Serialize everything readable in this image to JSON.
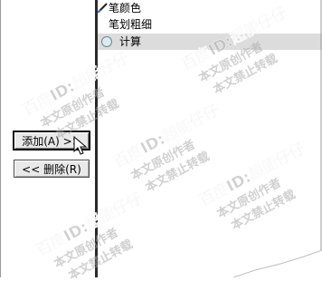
{
  "list": {
    "items": [
      {
        "label": "笔颜色",
        "icon": "pen-icon"
      },
      {
        "label": "笔划粗细",
        "icon": ""
      },
      {
        "label": "计算",
        "icon": "circle-icon",
        "selected": true
      }
    ]
  },
  "buttons": {
    "add_label": "添加(A) >>",
    "delete_label": "<< 删除(R)"
  },
  "watermark": {
    "line1": "百度ID:超能仔仔",
    "line2": "本文原创作者",
    "line3": "本文禁止转载"
  },
  "colors": {
    "selection": "#dcdcdc",
    "watermark": "#aaaaaa"
  }
}
